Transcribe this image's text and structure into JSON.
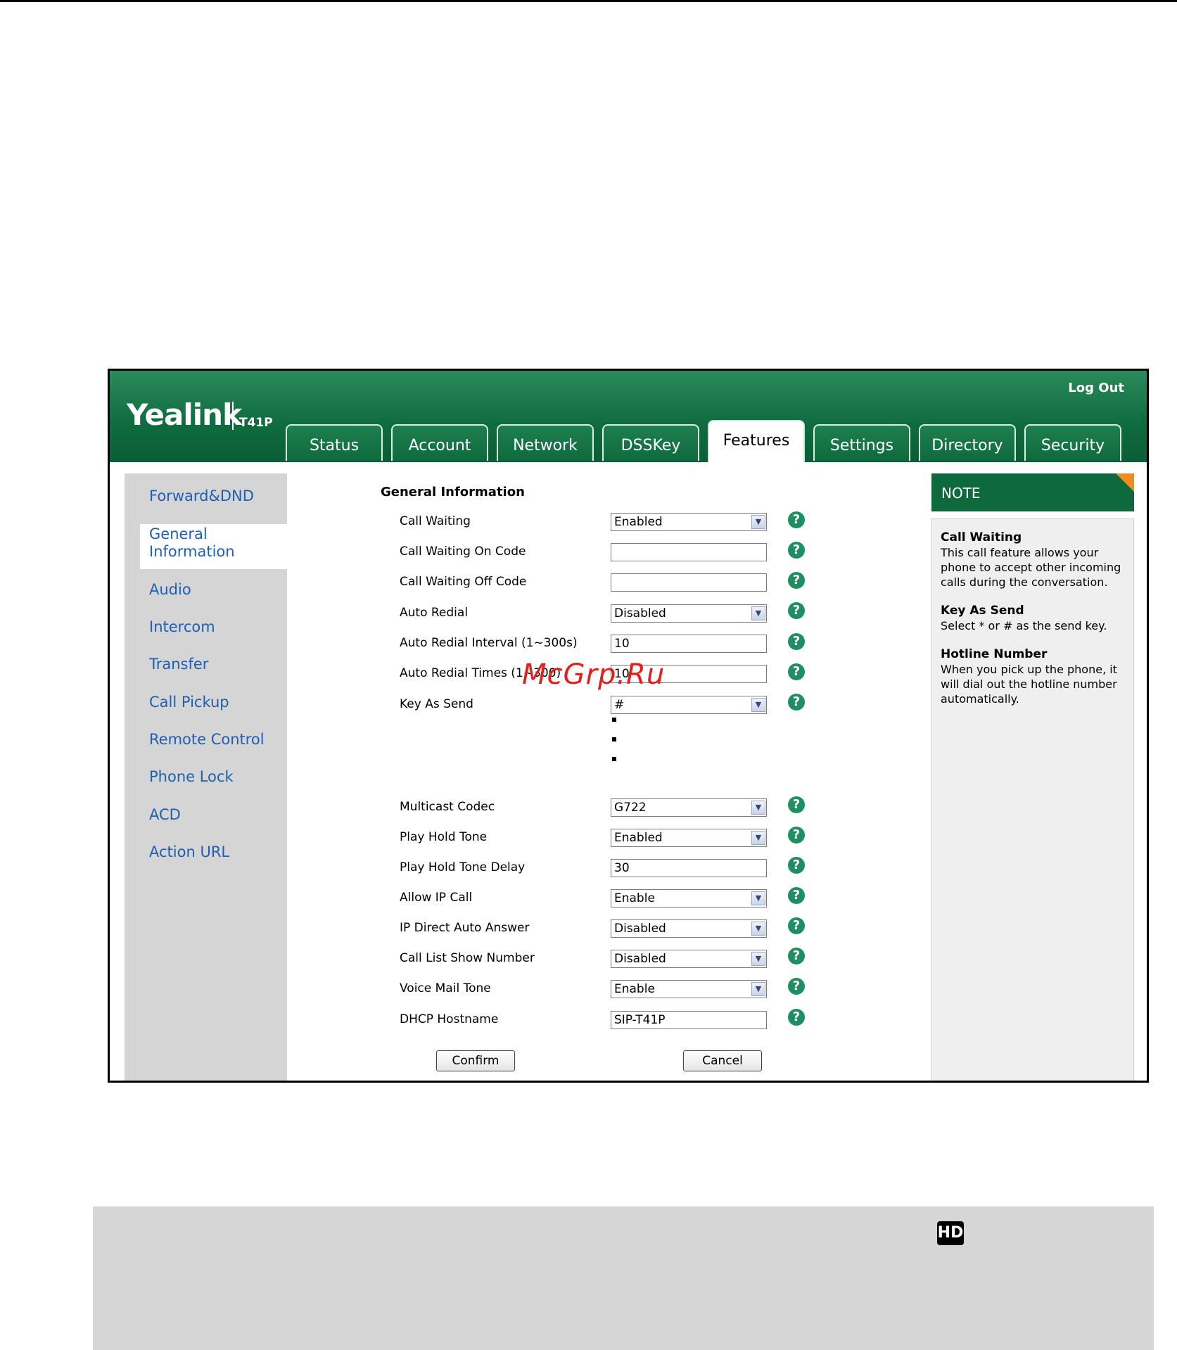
{
  "header": {
    "brand": "Yealink",
    "model": "T41P",
    "logout": "Log Out",
    "tabs": [
      "Status",
      "Account",
      "Network",
      "DSSKey",
      "Features",
      "Settings",
      "Directory",
      "Security"
    ],
    "active_tab": "Features"
  },
  "sidebar": {
    "items": [
      "Forward&DND",
      "General Information",
      "Audio",
      "Intercom",
      "Transfer",
      "Call Pickup",
      "Remote Control",
      "Phone Lock",
      "ACD",
      "Action URL"
    ],
    "active": "General Information",
    "general_line1": "General",
    "general_line2": "Information"
  },
  "main": {
    "section_title": "General Information",
    "rows": [
      {
        "label": "Call Waiting",
        "type": "select",
        "value": "Enabled"
      },
      {
        "label": "Call Waiting On Code",
        "type": "input",
        "value": ""
      },
      {
        "label": "Call Waiting Off Code",
        "type": "input",
        "value": ""
      },
      {
        "label": "Auto Redial",
        "type": "select",
        "value": "Disabled"
      },
      {
        "label": "Auto Redial Interval (1~300s)",
        "type": "input",
        "value": "10"
      },
      {
        "label": "Auto Redial Times (1~300)",
        "type": "input",
        "value": "10"
      },
      {
        "label": "Key As Send",
        "type": "select",
        "value": "#"
      },
      {
        "label": "Multicast Codec",
        "type": "select",
        "value": "G722"
      },
      {
        "label": "Play Hold Tone",
        "type": "select",
        "value": "Enabled"
      },
      {
        "label": "Play Hold Tone Delay",
        "type": "input",
        "value": "30"
      },
      {
        "label": "Allow IP Call",
        "type": "select",
        "value": "Enable"
      },
      {
        "label": "IP Direct Auto Answer",
        "type": "select",
        "value": "Disabled"
      },
      {
        "label": "Call List Show Number",
        "type": "select",
        "value": "Disabled"
      },
      {
        "label": "Voice Mail Tone",
        "type": "select",
        "value": "Enable"
      },
      {
        "label": "DHCP Hostname",
        "type": "input",
        "value": "SIP-T41P"
      }
    ],
    "help_glyph": "?",
    "confirm": "Confirm",
    "cancel": "Cancel"
  },
  "note": {
    "title": "NOTE",
    "blocks": [
      {
        "heading": "Call Waiting",
        "text": "This call feature allows your phone to accept other incoming calls during the conversation."
      },
      {
        "heading": "Key As Send",
        "text": "Select * or # as the send key."
      },
      {
        "heading": "Hotline Number",
        "text": "When you pick up the phone, it will dial out the hotline number automatically."
      }
    ]
  },
  "watermark": "McGrp.Ru",
  "hd_badge": "HD",
  "colors": {
    "brand_green": "#0e6a3d",
    "nav_link": "#1e5fb3",
    "note_corner": "#f08b1c",
    "help_icon": "#1d8f63"
  }
}
